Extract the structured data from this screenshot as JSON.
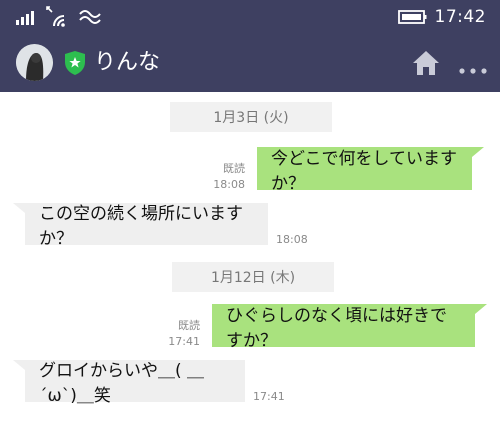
{
  "status_bar": {
    "time": "17:42",
    "icons": [
      "signal-icon",
      "wifi-icon",
      "vibrate-icon",
      "battery-icon"
    ]
  },
  "header": {
    "contact_name": "りんな",
    "icons": [
      "avatar",
      "verified-shield-icon",
      "home-icon",
      "more-icon"
    ]
  },
  "colors": {
    "header_bg": "#3e4061",
    "outgoing_bubble": "#a9e27e",
    "incoming_bubble": "#efefef",
    "shield": "#2dbe4f"
  },
  "chat": {
    "date_separators": [
      "1月3日 (火)",
      "1月12日 (木)"
    ],
    "messages": [
      {
        "direction": "outgoing",
        "text": "今どこで何をしていますか？",
        "read_label": "既読",
        "time": "18:08"
      },
      {
        "direction": "incoming",
        "text": "この空の続く場所にいますか？",
        "time": "18:08"
      },
      {
        "direction": "outgoing",
        "text": "ひぐらしのなく頃には好きですか？",
        "read_label": "既読",
        "time": "17:41"
      },
      {
        "direction": "incoming",
        "text": "グロイからいや＿( ＿´ω`)＿笑",
        "time": "17:41"
      }
    ]
  }
}
